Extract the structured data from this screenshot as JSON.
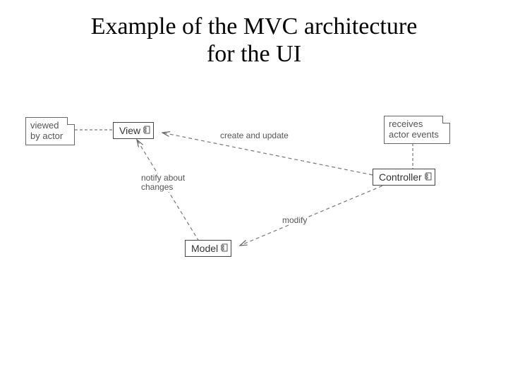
{
  "title_line1": "Example of the MVC architecture",
  "title_line2": "for the UI",
  "notes": {
    "viewed_by_actor": "viewed\nby actor",
    "receives_actor_events": "receives\nactor events"
  },
  "components": {
    "view": "View",
    "controller": "Controller",
    "model": "Model"
  },
  "labels": {
    "create_and_update": "create and update",
    "notify_about_changes": "notify about\nchanges",
    "modify": "modify"
  }
}
